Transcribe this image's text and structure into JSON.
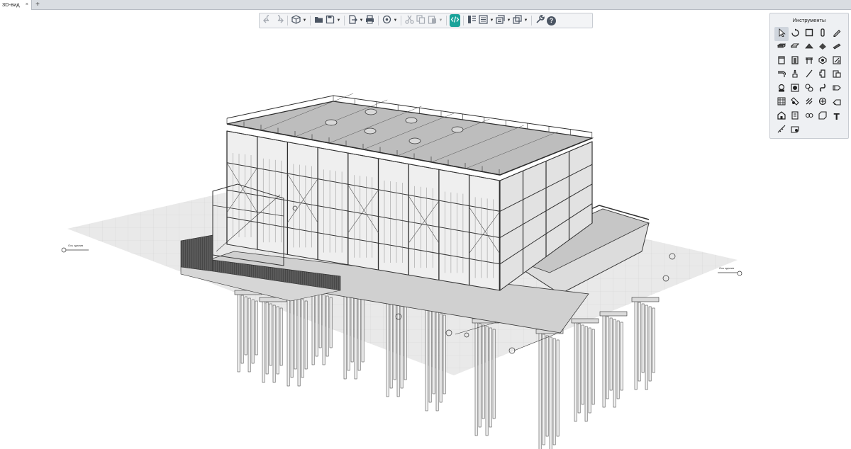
{
  "tabs": {
    "active_label": "3D-вид",
    "close_glyph": "×",
    "add_glyph": "+"
  },
  "toolbar": {
    "buttons": [
      {
        "name": "undo-icon",
        "state": "disabled"
      },
      {
        "name": "redo-icon",
        "state": "disabled"
      },
      {
        "name": "cube-view-icon",
        "dropdown": true
      },
      {
        "name": "open-folder-icon"
      },
      {
        "name": "save-icon",
        "dropdown": true
      },
      {
        "name": "export-icon",
        "dropdown": true
      },
      {
        "name": "print-icon"
      },
      {
        "name": "orbit-icon",
        "dropdown": true
      },
      {
        "name": "cut-icon",
        "state": "disabled"
      },
      {
        "name": "copy-icon",
        "state": "disabled"
      },
      {
        "name": "paste-icon",
        "dropdown": true,
        "state": "disabled"
      },
      {
        "name": "code-icon",
        "accent": "#1aa39a"
      },
      {
        "name": "properties-icon"
      },
      {
        "name": "view-list-icon",
        "dropdown": true
      },
      {
        "name": "layers-icon",
        "dropdown": true
      },
      {
        "name": "windows-icon",
        "dropdown": true
      },
      {
        "name": "wrench-icon"
      },
      {
        "name": "help-icon",
        "glyph": "?"
      }
    ]
  },
  "tools_panel": {
    "title": "Инструменты",
    "text_tool_glyph": "T",
    "tools": [
      "select-arrow-icon",
      "rotate-object-icon",
      "wall-icon",
      "column-icon",
      "pencil-icon",
      "beam-icon",
      "slab-icon",
      "roof-icon",
      "stair-icon",
      "ramp-icon",
      "door-icon",
      "window-icon",
      "truss-icon",
      "pile-icon",
      "foundation-icon",
      "pipe-icon",
      "valve-icon",
      "line-icon",
      "fitting-icon",
      "equipment-icon",
      "pump-icon",
      "tank-icon",
      "fan-icon",
      "duct-icon",
      "support-icon",
      "grid-icon",
      "hatch-icon",
      "dimension-icon",
      "level-icon",
      "section-icon",
      "room-icon",
      "elevation-icon",
      "rebar-icon",
      "label-icon",
      "text-icon",
      "measure-icon",
      "cloud-icon"
    ]
  },
  "scene": {
    "left_marker_label": "Ось здания",
    "right_marker_label": "Ось здания",
    "ground_color": "#e6e6e6",
    "structure_color": "#3a3a3a",
    "roof_color": "#b8b8b8",
    "fence_color": "#4a4a4a"
  }
}
